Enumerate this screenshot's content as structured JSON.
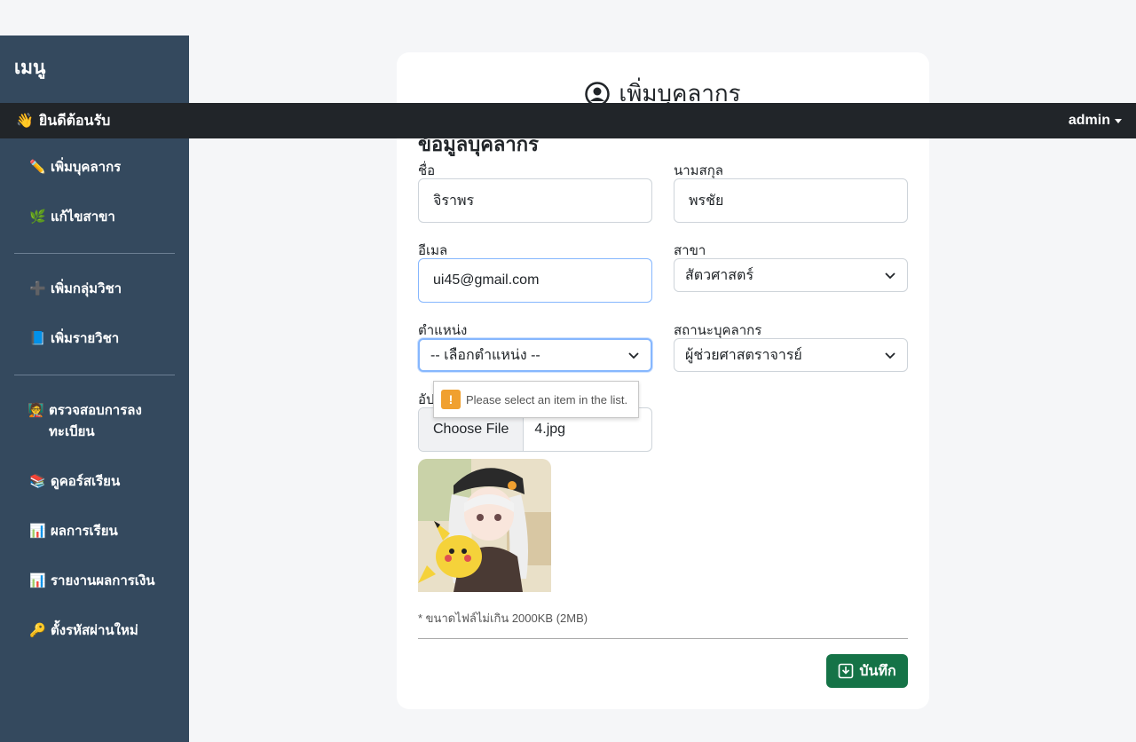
{
  "sidebar": {
    "title": "เมนู",
    "items": [
      {
        "icon": "pencil-icon",
        "glyph": "✏️",
        "label": "เพิ่มบุคลากร"
      },
      {
        "icon": "leaf-icon",
        "glyph": "🌿",
        "label": "แก้ไขสาขา"
      },
      {
        "icon": "plus-icon",
        "glyph": "➕",
        "label": "เพิ่มกลุ่มวิชา"
      },
      {
        "icon": "book-icon",
        "glyph": "📘",
        "label": "เพิ่มรายวิชา"
      },
      {
        "icon": "teacher-icon",
        "glyph": "🧑‍🏫",
        "label": "ตรวจสอบการลงทะเบียน"
      },
      {
        "icon": "books-icon",
        "glyph": "📚",
        "label": "ดูคอร์สเรียน"
      },
      {
        "icon": "bar-chart-icon",
        "glyph": "📊",
        "label": "ผลการเรียน"
      },
      {
        "icon": "bar-chart-icon",
        "glyph": "📊",
        "label": "รายงานผลการเงิน"
      },
      {
        "icon": "key-icon",
        "glyph": "🔑",
        "label": "ตั้งรหัสผ่านใหม่"
      }
    ]
  },
  "topbar": {
    "welcome_glyph": "👋",
    "welcome": "ยินดีต้อนรับ",
    "user": "admin"
  },
  "form": {
    "title": "เพิ่มบุคลากร",
    "section": "ข้อมูลบุคลากร",
    "first_name_label": "ชื่อ",
    "first_name_value": "จิราพร",
    "last_name_label": "นามสกุล",
    "last_name_value": "พรชัย",
    "email_label": "อีเมล",
    "email_value": "ui45@gmail.com",
    "branch_label": "สาขา",
    "branch_value": "สัตวศาสตร์",
    "position_label": "ตำแหน่ง",
    "position_value": "-- เลือกตำแหน่ง --",
    "status_label": "สถานะบุคลากร",
    "status_value": "ผู้ช่วยศาสตราจารย์",
    "upload_label": "อัปโหลดรูปภาพ",
    "file_button": "Choose File",
    "file_name": "4.jpg",
    "file_note": "* ขนาดไฟล์ไม่เกิน 2000KB (2MB)",
    "save_label": "บันทึก",
    "tooltip": "Please select an item in the list."
  },
  "colors": {
    "sidebar": "#34495e",
    "topbar": "#212529",
    "save": "#157347",
    "focus": "#86b7fe"
  }
}
